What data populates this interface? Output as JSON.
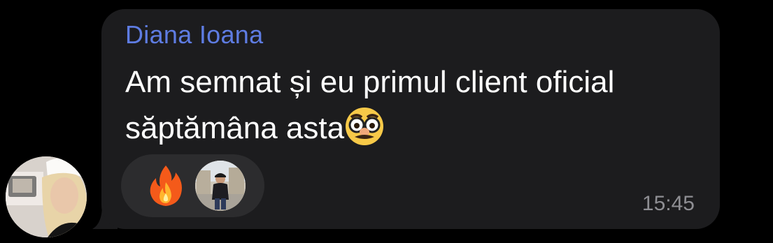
{
  "message": {
    "sender": "Diana Ioana",
    "text": "Am semnat și eu primul client oficial săptămâna asta",
    "time": "15:45",
    "trailing_emoji": "disguised-face-emoji"
  },
  "reactions": [
    {
      "emoji": "fire-emoji",
      "reactor": "user-avatar"
    }
  ],
  "colors": {
    "background": "#000000",
    "bubble": "#1c1c1e",
    "sender": "#5e7ce2",
    "text": "#ffffff",
    "reaction_pill": "#2c2c2e",
    "time": "#8e8e93"
  }
}
